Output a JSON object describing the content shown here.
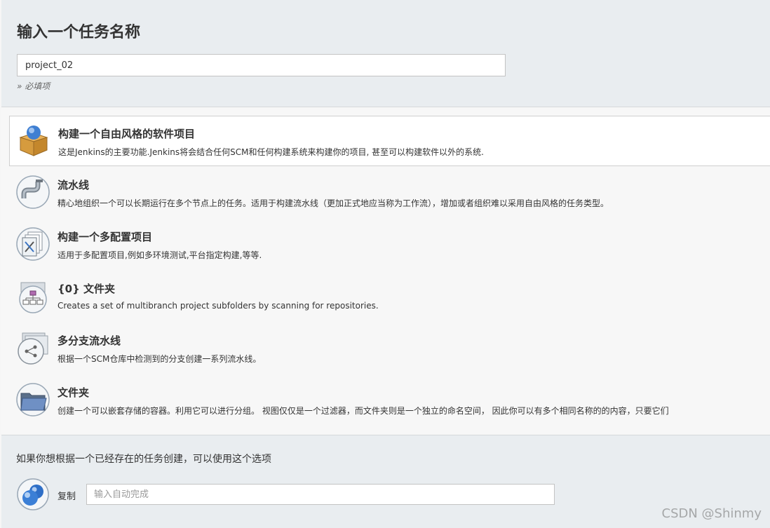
{
  "header": {
    "title": "输入一个任务名称",
    "name_value": "project_02",
    "required_hint": "» 必填项"
  },
  "items": [
    {
      "title": "构建一个自由风格的软件项目",
      "desc": "这是Jenkins的主要功能.Jenkins将会结合任何SCM和任何构建系统来构建你的项目, 甚至可以构建软件以外的系统.",
      "icon": "freestyle-box-icon",
      "selected": true
    },
    {
      "title": "流水线",
      "desc": "精心地组织一个可以长期运行在多个节点上的任务。适用于构建流水线（更加正式地应当称为工作流），增加或者组织难以采用自由风格的任务类型。",
      "icon": "pipeline-icon",
      "selected": false
    },
    {
      "title": "构建一个多配置项目",
      "desc": "适用于多配置项目,例如多环境测试,平台指定构建,等等.",
      "icon": "multi-config-icon",
      "selected": false
    },
    {
      "title": "{0} 文件夹",
      "desc": "Creates a set of multibranch project subfolders by scanning for repositories.",
      "icon": "org-folder-icon",
      "selected": false
    },
    {
      "title": "多分支流水线",
      "desc": "根据一个SCM仓库中检测到的分支创建一系列流水线。",
      "icon": "multibranch-icon",
      "selected": false
    },
    {
      "title": "文件夹",
      "desc": "创建一个可以嵌套存储的容器。利用它可以进行分组。 视图仅仅是一个过滤器，而文件夹则是一个独立的命名空间， 因此你可以有多个相同名称的的内容，只要它们",
      "icon": "folder-icon",
      "selected": false
    }
  ],
  "copy": {
    "hint": "如果你想根据一个已经存在的任务创建，可以使用这个选项",
    "label": "复制",
    "placeholder": "输入自动完成",
    "icon": "copy-job-icon"
  },
  "watermark": "CSDN @Shinmy"
}
